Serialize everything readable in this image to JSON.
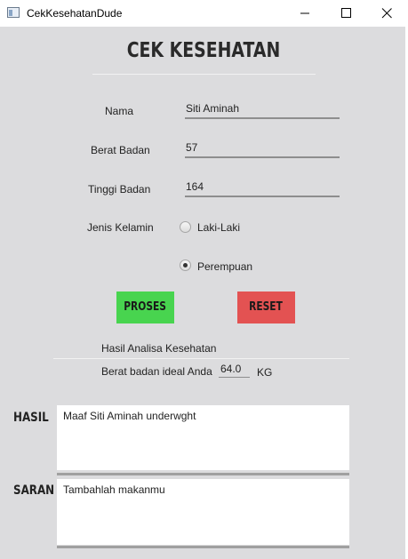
{
  "window": {
    "title": "CekKesehatanDude"
  },
  "heading": "CEK KESEHATAN",
  "form": {
    "nama_label": "Nama",
    "nama_value": "Siti Aminah",
    "berat_label": "Berat Badan",
    "berat_value": "57",
    "tinggi_label": "Tinggi Badan",
    "tinggi_value": "164",
    "gender_label": "Jenis Kelamin",
    "gender_options": [
      {
        "label": "Laki-Laki",
        "selected": false
      },
      {
        "label": "Perempuan",
        "selected": true
      }
    ]
  },
  "buttons": {
    "proses": "PROSES",
    "reset": "RESET",
    "proses_color": "#48d44f",
    "reset_color": "#e35252"
  },
  "result": {
    "section_title": "Hasil Analisa Kesehatan",
    "ideal_label": "Berat badan ideal Anda",
    "ideal_value": "64.0",
    "ideal_unit": "KG",
    "hasil_label": "HASIL",
    "hasil_text": "Maaf Siti Aminah underwght",
    "saran_label": "SARAN",
    "saran_text": "Tambahlah makanmu"
  }
}
